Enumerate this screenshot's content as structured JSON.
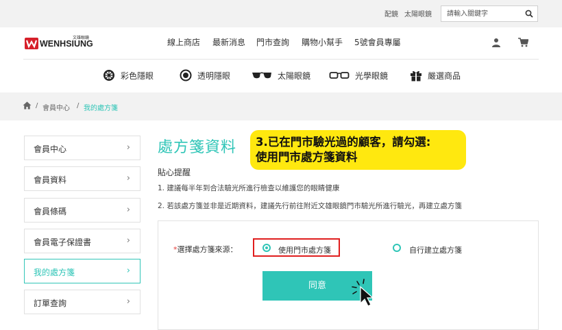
{
  "topbar": {
    "links": [
      "配鏡",
      "太陽眼鏡"
    ],
    "search_placeholder": "請輸入關鍵字"
  },
  "brand": {
    "name": "WENHSIUNG",
    "chinese": "文雄眼鏡"
  },
  "main_nav": [
    "線上商店",
    "最新消息",
    "門市查詢",
    "購物小幫手",
    "5號會員專屬"
  ],
  "categories": [
    {
      "label": "彩色隱眼",
      "icon": "colored-lens-icon"
    },
    {
      "label": "透明隱眼",
      "icon": "clear-lens-icon"
    },
    {
      "label": "太陽眼鏡",
      "icon": "sunglasses-icon"
    },
    {
      "label": "光學眼鏡",
      "icon": "optical-glasses-icon"
    },
    {
      "label": "嚴選商品",
      "icon": "gift-icon"
    }
  ],
  "breadcrumb": {
    "separator": "/",
    "items": [
      "會員中心",
      "我的處方箋"
    ]
  },
  "sidebar": {
    "items": [
      {
        "label": "會員中心",
        "active": false
      },
      {
        "label": "會員資料",
        "active": false
      },
      {
        "label": "會員條碼",
        "active": false
      },
      {
        "label": "會員電子保證書",
        "active": false
      },
      {
        "label": "我的處方箋",
        "active": true
      },
      {
        "label": "訂單查詢",
        "active": false
      }
    ],
    "chevron": "›"
  },
  "main": {
    "title": "處方箋資料",
    "callout_line1": "3.已在門市驗光過的顧客，請勾選:",
    "callout_line2": "使用門市處方箋資料",
    "tips_heading": "貼心提醒",
    "tips": [
      "1. 建議每半年到合法驗光所進行檢查以維護您的眼睛健康",
      "2. 若該處方箋並非是近期資料，建議先行前往附近文雄眼鏡門市驗光所進行驗光，再建立處方箋"
    ],
    "source_label_star": "*",
    "source_label": "選擇處方箋來源：",
    "options": [
      {
        "label": "使用門市處方箋",
        "selected": true
      },
      {
        "label": "自行建立處方箋",
        "selected": false
      }
    ],
    "agree_label": "同意"
  },
  "colors": {
    "accent": "#2fc5b7",
    "callout": "#ffe80f",
    "highlight": "#e01d1d",
    "brand_red": "#d6202a"
  }
}
